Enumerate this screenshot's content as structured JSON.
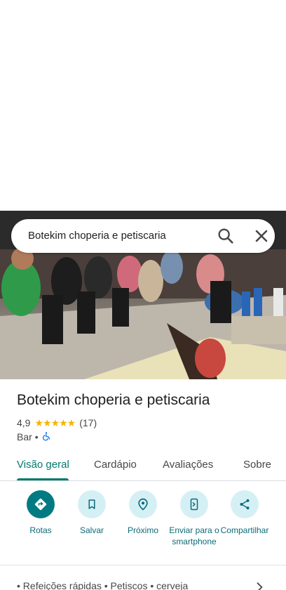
{
  "search": {
    "query": "Botekim choperia e petiscaria"
  },
  "place": {
    "name": "Botekim choperia e petiscaria",
    "rating": "4,9",
    "stars": "★★★★★",
    "review_count": "(17)",
    "category": "Bar",
    "separator": "•"
  },
  "tabs": [
    {
      "label": "Visão geral",
      "active": true
    },
    {
      "label": "Cardápio"
    },
    {
      "label": "Avaliações"
    },
    {
      "label": "Sobre"
    }
  ],
  "actions": [
    {
      "label": "Rotas",
      "icon": "directions-icon"
    },
    {
      "label": "Salvar",
      "icon": "bookmark-icon"
    },
    {
      "label": "Próximo",
      "icon": "nearby-icon"
    },
    {
      "label": "Enviar para o smartphone",
      "icon": "send-to-phone-icon"
    },
    {
      "label": "Compartilhar",
      "icon": "share-icon"
    }
  ],
  "bottom": {
    "summary_text": "• Refeições rápidas • Petiscos • cerveja"
  },
  "colors": {
    "accent": "#00796b",
    "action_bg": "#d5f0f5",
    "primary_action": "#007b83",
    "star": "#f5b400"
  }
}
